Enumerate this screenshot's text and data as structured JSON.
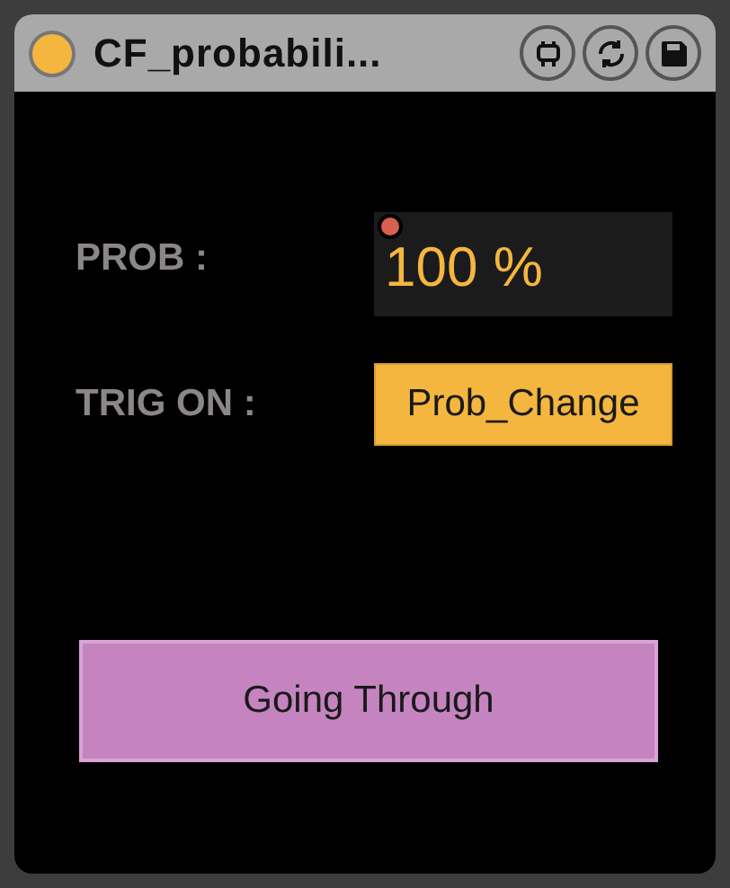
{
  "device": {
    "title": "CF_probabili...",
    "on": true
  },
  "fields": [
    {
      "kind": "number",
      "label": "PROB :",
      "value": "100 %"
    },
    {
      "kind": "menu",
      "label": "TRIG ON :",
      "value": "Prob_Change"
    }
  ],
  "button": {
    "label": "Going Through"
  }
}
